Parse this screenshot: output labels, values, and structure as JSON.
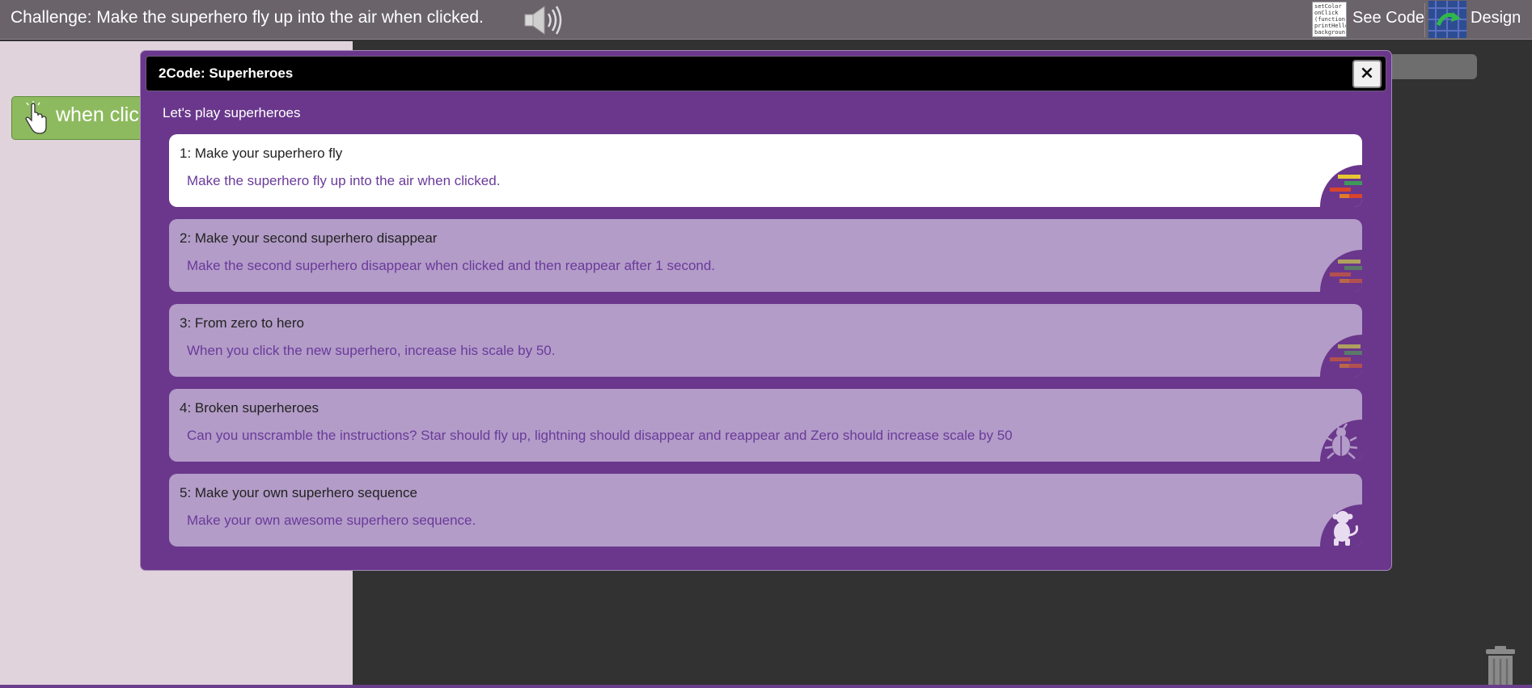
{
  "topbar": {
    "challenge_text": "Challenge: Make the superhero fly up into the air when clicked.",
    "speaker_icon": "speaker-icon",
    "code_thumbnail_lines": [
      "setColor",
      "onClick",
      "(function (",
      "printHello",
      "backgroun"
    ],
    "see_code_label": "See Code",
    "design_label": "Design"
  },
  "palette": {
    "when_block_label": "when clicked"
  },
  "dialog": {
    "title": "2Code: Superheroes",
    "close_label": "×",
    "subtitle": "Let's play superheroes",
    "cards": [
      {
        "title": "1: Make your superhero fly",
        "description": "Make the superhero fly up into the air when clicked.",
        "icon": "code-blocks-icon",
        "active": true
      },
      {
        "title": "2: Make your second superhero disappear",
        "description": "Make the second superhero disappear when clicked and then reappear after 1 second.",
        "icon": "code-blocks-icon",
        "active": false
      },
      {
        "title": "3: From zero to hero",
        "description": "When you click the new superhero, increase his scale by 50.",
        "icon": "code-blocks-icon",
        "active": false
      },
      {
        "title": "4: Broken superheroes",
        "description": "Can you unscramble the instructions? Star should fly up, lightning should disappear and reappear and Zero should increase scale by 50",
        "icon": "bug-icon",
        "active": false
      },
      {
        "title": "5: Make your own superhero sequence",
        "description": "Make your own awesome superhero sequence.",
        "icon": "monkey-icon",
        "active": false
      }
    ]
  },
  "colors": {
    "dialog_background": "#6a378c",
    "active_card": "#ffffff",
    "inactive_card": "#b39cc8",
    "event_block": "#8dba5e",
    "topbar": "#6a636a"
  }
}
